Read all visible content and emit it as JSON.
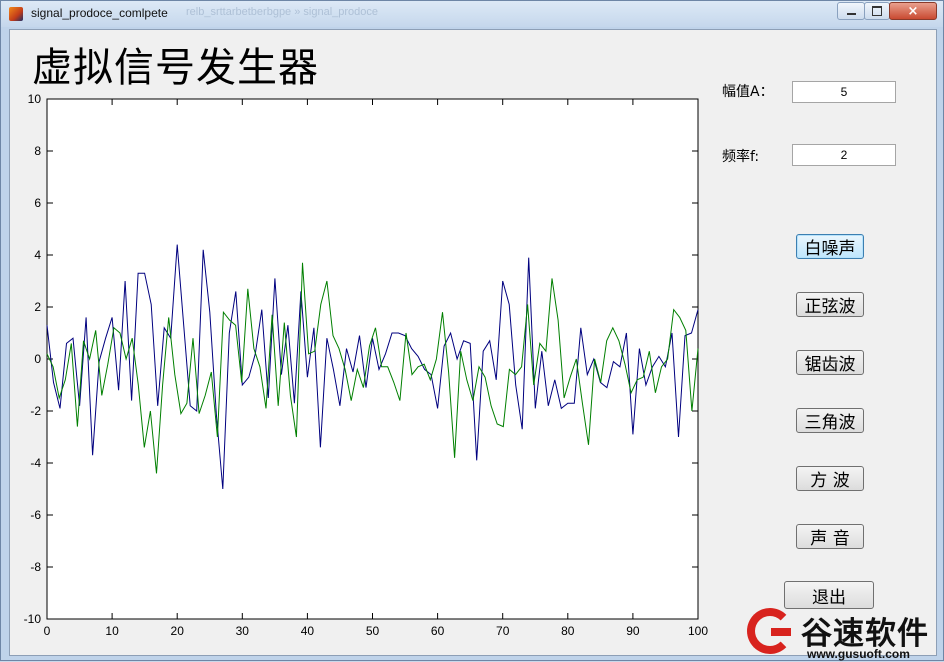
{
  "window": {
    "title": "signal_prodoce_comlpete",
    "ghost_title": "relb_srttarbetberbgpe  »  signal_prodoce",
    "close_symbol": "×"
  },
  "app": {
    "heading": "虚拟信号发生器"
  },
  "params": {
    "amplitude_label": "幅值A：",
    "amplitude_value": "5",
    "frequency_label": "频率f:",
    "frequency_value": "2"
  },
  "buttons": {
    "white_noise": "白噪声",
    "sine_wave": "正弦波",
    "sawtooth_wave": "锯齿波",
    "triangle_wave": "三角波",
    "square_wave": "方  波",
    "sound": "声  音",
    "exit": "退出"
  },
  "watermark": {
    "name": "谷速软件",
    "url": "www.gusuoft.com"
  },
  "chart_data": {
    "type": "line",
    "title": "",
    "xlabel": "",
    "ylabel": "",
    "xlim": [
      0,
      100
    ],
    "ylim": [
      -10,
      10
    ],
    "xticks": [
      0,
      10,
      20,
      30,
      40,
      50,
      60,
      70,
      80,
      90,
      100
    ],
    "yticks": [
      10,
      8,
      6,
      4,
      2,
      0,
      -2,
      -4,
      -6,
      -8,
      -10
    ],
    "grid": false,
    "series": [
      {
        "color": "#00007f",
        "values": [
          1.3,
          -0.9,
          -1.9,
          0.6,
          0.8,
          -1.8,
          1.6,
          -3.7,
          -0.1,
          0.8,
          1.6,
          -1.2,
          3.0,
          -1.6,
          3.3,
          3.3,
          2.1,
          -1.8,
          1.2,
          0.8,
          4.4,
          1.3,
          -1.8,
          -2.0,
          4.2,
          1.8,
          -2.1,
          -5.0,
          1.0,
          2.6,
          -1.0,
          -0.7,
          0.2,
          1.9,
          -1.5,
          3.1,
          -0.6,
          1.3,
          -1.7,
          2.6,
          -0.7,
          1.2,
          -3.4,
          0.8,
          -0.4,
          -1.8,
          0.4,
          -0.5,
          0.9,
          -1.1,
          0.8,
          -0.4,
          0.2,
          1.0,
          1.0,
          0.9,
          0.4,
          0.1,
          -0.4,
          -0.6,
          -1.9,
          0.5,
          1.0,
          0.0,
          0.7,
          0.6,
          -3.9,
          0.3,
          0.7,
          -0.8,
          3.0,
          2.1,
          -1.0,
          -2.7,
          3.9,
          -1.9,
          0.3,
          -1.8,
          -0.8,
          -1.9,
          -1.7,
          -1.7,
          1.2,
          -0.6,
          0.0,
          -0.9,
          -1.1,
          -0.1,
          -0.3,
          1.0,
          -2.9,
          0.4,
          -1.0,
          -0.3,
          0.1,
          -0.3,
          1.0,
          -3.0,
          0.9,
          1.0,
          1.9
        ]
      },
      {
        "color": "#007f00",
        "values": [
          0.2,
          -0.3,
          -1.5,
          -0.8,
          0.6,
          -2.6,
          0.7,
          0.0,
          1.1,
          -1.4,
          -0.2,
          1.2,
          1.0,
          0.0,
          0.8,
          -1.0,
          -3.4,
          -2.0,
          -4.4,
          -1.0,
          1.6,
          -0.6,
          -2.1,
          -1.7,
          0.8,
          -2.1,
          -1.4,
          -0.5,
          -3.0,
          1.8,
          1.5,
          1.3,
          -0.9,
          2.7,
          0.4,
          -0.3,
          -1.9,
          1.7,
          -1.8,
          1.4,
          -1.4,
          -3.0,
          3.7,
          0.2,
          0.3,
          2.1,
          3.0,
          0.9,
          0.4,
          -0.4,
          -1.6,
          -0.4,
          -1.1,
          0.5,
          1.2,
          -0.3,
          -0.3,
          -0.9,
          -1.6,
          1.0,
          -0.6,
          -0.3,
          -0.2,
          -0.8,
          0.0,
          1.8,
          -0.5,
          -3.8,
          0.3,
          -0.8,
          -1.6,
          -0.3,
          -0.7,
          -1.8,
          -2.5,
          -2.6,
          -0.4,
          -0.6,
          -0.3,
          2.1,
          -1.0,
          0.6,
          0.3,
          3.1,
          1.5,
          -1.5,
          -0.7,
          0.0,
          -1.7,
          -3.3,
          0.0,
          -0.9,
          0.7,
          1.2,
          0.7,
          -0.2,
          -1.3,
          -0.8,
          -0.7,
          0.3,
          -1.3,
          -0.3,
          0.0,
          1.9,
          1.6,
          1.1,
          -2.0,
          0.4
        ]
      }
    ]
  }
}
